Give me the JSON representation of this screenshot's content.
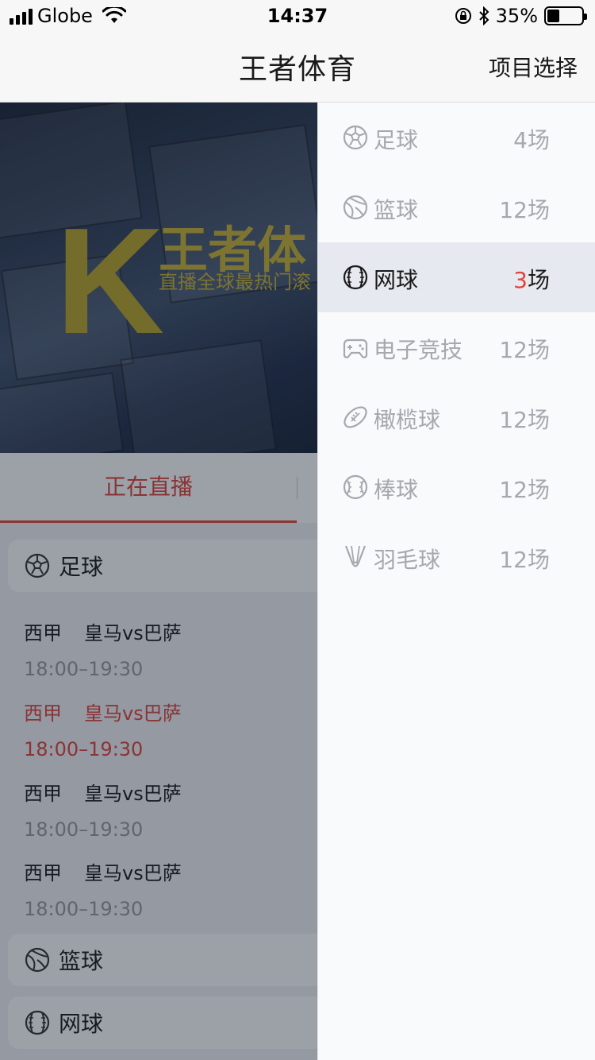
{
  "status_bar": {
    "carrier": "Globe",
    "time": "14:37",
    "battery": "35%",
    "battery_level": 0.35
  },
  "nav": {
    "title": "王者体育",
    "action": "项目选择"
  },
  "banner": {
    "big_letter": "K",
    "title": "王者体",
    "subtitle": "直播全球最热门滚"
  },
  "tabs": {
    "live": "正在直播"
  },
  "main": {
    "categories": [
      {
        "label": "足球",
        "icon": "soccer-ball-icon"
      },
      {
        "label": "篮球",
        "icon": "basketball-icon"
      },
      {
        "label": "网球",
        "icon": "tennis-ball-icon"
      }
    ],
    "matches": [
      {
        "league": "西甲",
        "teams": "皇马vs巴萨",
        "time": "18:00–19:30"
      },
      {
        "league": "西甲",
        "teams": "皇马vs巴萨",
        "time": "18:00–19:30"
      },
      {
        "league": "西甲",
        "teams": "皇马vs巴萨",
        "time": "18:00–19:30"
      },
      {
        "league": "西甲",
        "teams": "皇马vs巴萨",
        "time": "18:00–19:30"
      }
    ]
  },
  "drawer": {
    "items": [
      {
        "label": "足球",
        "count": "4",
        "unit": "场",
        "icon": "soccer-ball-icon"
      },
      {
        "label": "篮球",
        "count": "12",
        "unit": "场",
        "icon": "basketball-icon"
      },
      {
        "label": "网球",
        "count": "3",
        "unit": "场",
        "icon": "tennis-ball-icon"
      },
      {
        "label": "电子竞技",
        "count": "12",
        "unit": "场",
        "icon": "gamepad-icon"
      },
      {
        "label": "橄榄球",
        "count": "12",
        "unit": "场",
        "icon": "football-icon"
      },
      {
        "label": "棒球",
        "count": "12",
        "unit": "场",
        "icon": "baseball-icon"
      },
      {
        "label": "羽毛球",
        "count": "12",
        "unit": "场",
        "icon": "shuttlecock-icon"
      }
    ]
  },
  "colors": {
    "accent": "#e0453c",
    "muted": "#a6a8ad",
    "banner_gold": "#c9b332"
  }
}
